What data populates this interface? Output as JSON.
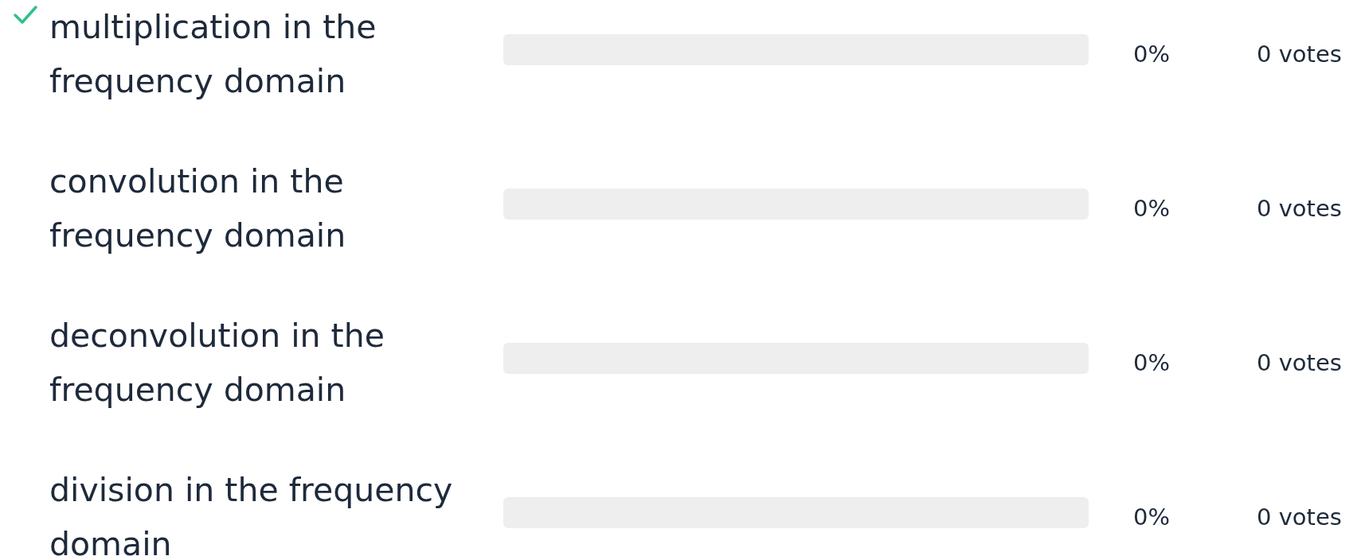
{
  "options": [
    {
      "label": "multiplication in the frequency domain",
      "correct": true,
      "level": 0,
      "percent": "0%",
      "votes": "0 votes"
    },
    {
      "label": "convolution in the frequency domain",
      "correct": false,
      "level": 0,
      "percent": "0%",
      "votes": "0 votes"
    },
    {
      "label": "deconvolution in the frequency domain",
      "correct": false,
      "level": 0,
      "percent": "0%",
      "votes": "0 votes"
    },
    {
      "label": "division in the frequency domain",
      "correct": false,
      "level": 0,
      "percent": "0%",
      "votes": "0 votes"
    }
  ]
}
